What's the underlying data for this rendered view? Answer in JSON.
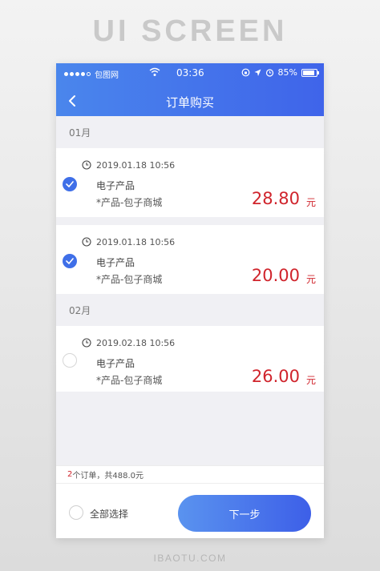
{
  "poster": {
    "title": "UI SCREEN",
    "footer": "IBAOTU.COM"
  },
  "status_bar": {
    "carrier": "包图网",
    "time": "03:36",
    "battery": "85%"
  },
  "nav": {
    "title": "订单购买"
  },
  "sections": [
    {
      "label": "01月",
      "orders": [
        {
          "time": "2019.01.18 10:56",
          "name": "电子产品",
          "shop": "*产品-包子商城",
          "price": "28.80",
          "unit": "元",
          "checked": true
        },
        {
          "time": "2019.01.18 10:56",
          "name": "电子产品",
          "shop": "*产品-包子商城",
          "price": "20.00",
          "unit": "元",
          "checked": true
        }
      ]
    },
    {
      "label": "02月",
      "orders": [
        {
          "time": "2019.02.18 10:56",
          "name": "电子产品",
          "shop": "*产品-包子商城",
          "price": "26.00",
          "unit": "元",
          "checked": false
        }
      ]
    }
  ],
  "summary": {
    "count": "2",
    "text": "个订单，共488.0元"
  },
  "footer_actions": {
    "select_all_label": "全部选择",
    "next_label": "下一步"
  },
  "colors": {
    "accent": "#3f6fe8",
    "price": "#d0242c"
  }
}
